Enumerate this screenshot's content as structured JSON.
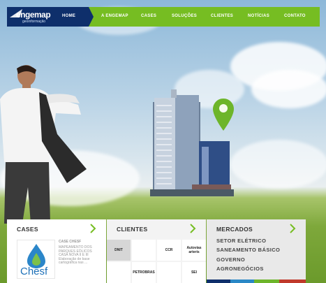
{
  "brand": {
    "name": "engemap",
    "tagline": "geoinformação"
  },
  "nav": {
    "home": "HOME",
    "items": [
      "A ENGEMAP",
      "CASES",
      "SOLUÇÕES",
      "CLIENTES",
      "NOTÍCIAS",
      "CONTATO"
    ]
  },
  "panels": {
    "cases": {
      "title": "CASES",
      "case_logo_text": "Chesf",
      "case_title": "CASE CHESF",
      "case_desc": "MAPEAMENTO DOS PARQUES EÓLICOS CASA NOVA II E III Elaboração de base cartográfica nas ..."
    },
    "clientes": {
      "title": "CLIENTES",
      "logos": [
        "DNIT",
        "",
        "CCR",
        "Autovias arteris",
        "",
        "PETROBRAS",
        "",
        "SEI"
      ]
    },
    "mercados": {
      "title": "MERCADOS",
      "items": [
        "SETOR ELÉTRICO",
        "SANEAMENTO BÁSICO",
        "GOVERNO",
        "AGRONEGÓCIOS"
      ]
    }
  },
  "colors": {
    "nav_green": "#76bd22",
    "nav_blue": "#0e2f6b",
    "chevron_green": "#76bd22"
  }
}
